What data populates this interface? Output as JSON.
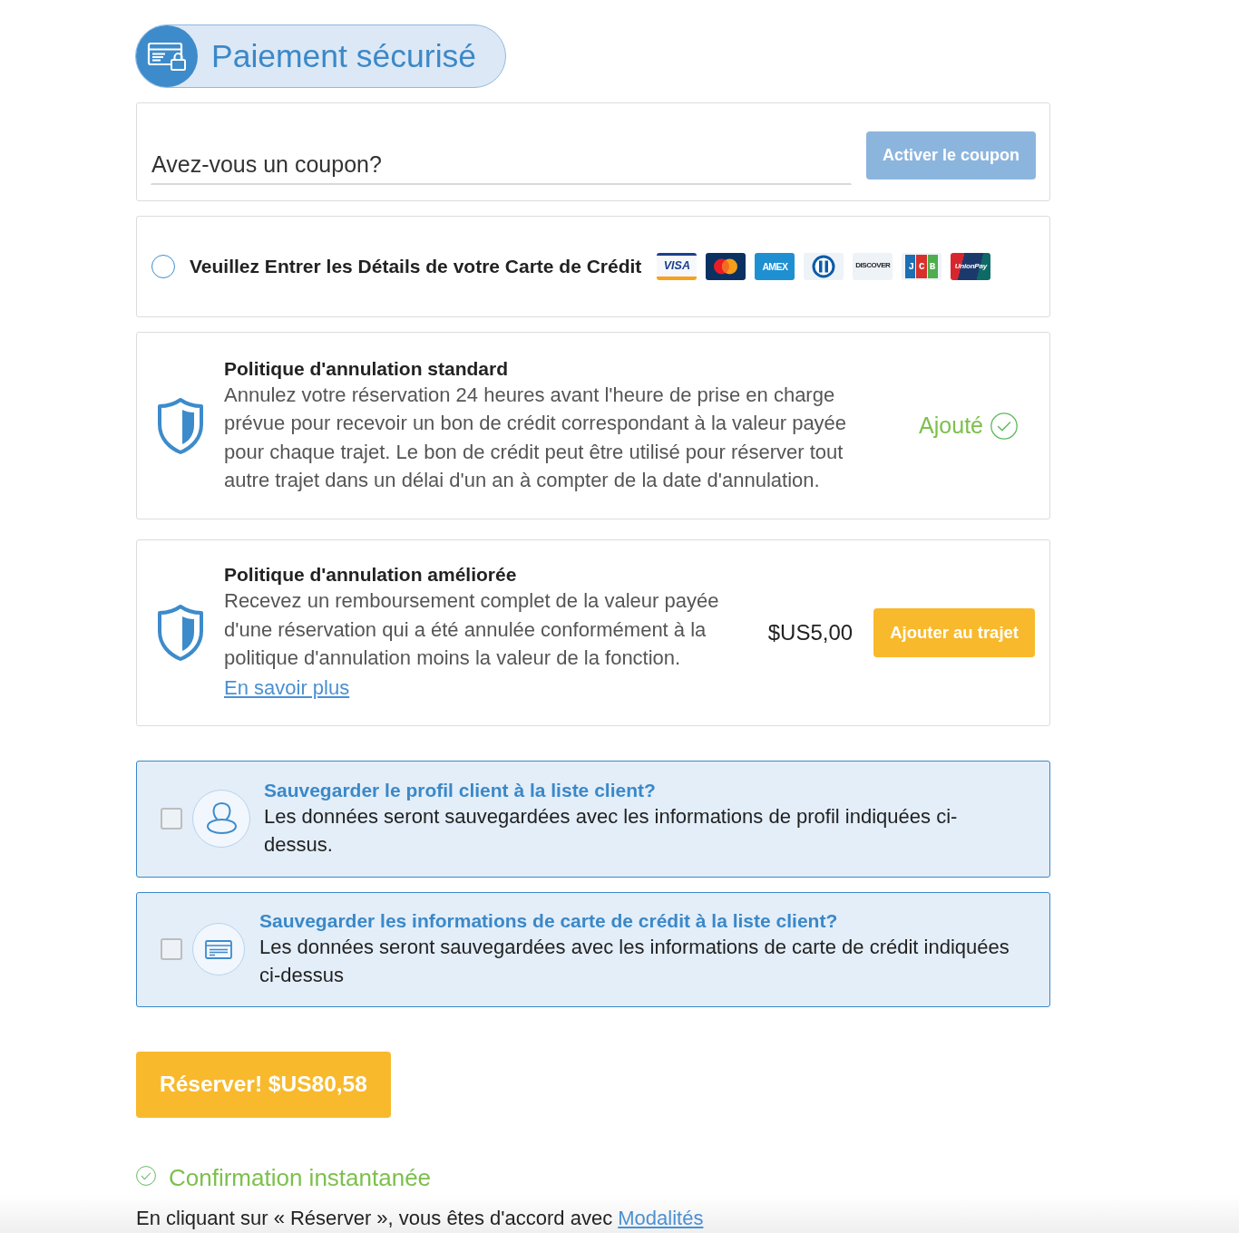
{
  "header": {
    "title": "Paiement sécurisé"
  },
  "coupon": {
    "placeholder": "Avez-vous un coupon?",
    "button": "Activer le coupon"
  },
  "card_payment": {
    "label": "Veuillez Entrer les Détails de votre Carte de Crédit",
    "selected": false,
    "logos": [
      {
        "kind": "visa",
        "text": "VISA"
      },
      {
        "kind": "mastercard"
      },
      {
        "kind": "amex",
        "text": "AMEX"
      },
      {
        "kind": "diners"
      },
      {
        "kind": "discover",
        "text": "DISCOVER"
      },
      {
        "kind": "jcb",
        "text": "JCB"
      },
      {
        "kind": "unionpay",
        "text": "UnionPay"
      }
    ]
  },
  "policies": [
    {
      "kind": "added",
      "title": "Politique d'annulation standard",
      "description": "Annulez votre réservation 24 heures avant l'heure de prise en charge prévue pour recevoir un bon de crédit correspondant à la valeur payée pour chaque trajet. Le bon de crédit peut être utilisé pour réserver tout autre trajet dans un délai d'un an à compter de la date d'annulation.",
      "status": "Ajouté"
    },
    {
      "kind": "offer",
      "title": "Politique d'annulation améliorée",
      "description": "Recevez un remboursement complet de la valeur payée d'une réservation qui a été annulée conformément à la politique d'annulation moins la valeur de la fonction.",
      "link": "En savoir plus",
      "price": "$US5,00",
      "button": "Ajouter au trajet"
    }
  ],
  "save_options": [
    {
      "kind": "profile",
      "title": "Sauvegarder le profil client à la liste client?",
      "description": "Les données seront sauvegardées avec les informations de profil indiquées ci-dessus.",
      "checked": false
    },
    {
      "kind": "card",
      "title": "Sauvegarder les informations de carte de crédit à la liste client?",
      "description": "Les données seront sauvegardées avec les informations de carte de crédit indiquées ci-dessus",
      "checked": false
    }
  ],
  "reserve_button": "Réserver! $US80,58",
  "confirmation": "Confirmation instantanée",
  "terms": {
    "text": "En cliquant sur « Réserver », vous êtes d'accord avec",
    "link": "Modalités"
  }
}
